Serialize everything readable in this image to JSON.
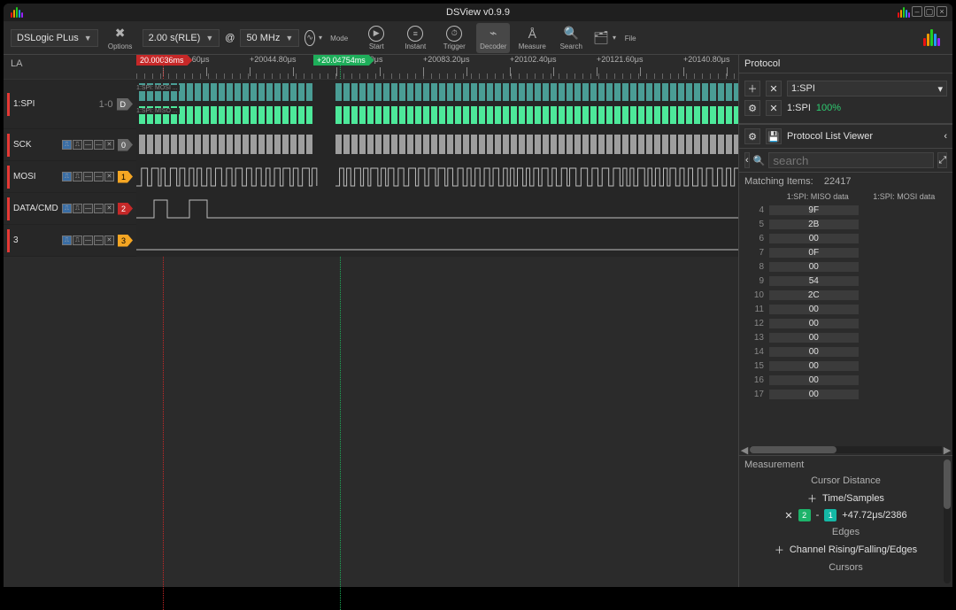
{
  "title": "DSView v0.9.9",
  "toolbar": {
    "device": "DSLogic PLus",
    "options_label": "Options",
    "duration": "2.00 s(RLE)",
    "at": "@",
    "rate": "50 MHz",
    "mode_label": "Mode",
    "start_label": "Start",
    "instant_label": "Instant",
    "trigger_label": "Trigger",
    "decoder_label": "Decoder",
    "measure_label": "Measure",
    "search_label": "Search",
    "file_label": "File"
  },
  "ruler": {
    "la": "LA",
    "cursor_red": "20.00036ms",
    "cursor_green": "+20.04754ms",
    "ticks": [
      "+20025.60μs",
      "",
      "+20044.80μs",
      "",
      "+20064.00μs",
      "",
      "+20083.20μs",
      "",
      "+20102.40μs",
      "",
      "+20121.60μs",
      "",
      "+20140.80μs",
      ""
    ]
  },
  "channels": [
    {
      "name": "1:SPI",
      "idx": "D",
      "idx_color": "grey",
      "decode": true,
      "sub": [
        "1:SPI: MOSI ...",
        "1:SPI: MISO ..."
      ]
    },
    {
      "name": "SCK",
      "idx": "0",
      "idx_color": "grey",
      "decode": false
    },
    {
      "name": "MOSI",
      "idx": "1",
      "idx_color": "orange",
      "decode": false
    },
    {
      "name": "DATA/CMD",
      "idx": "2",
      "idx_color": "red",
      "decode": false
    },
    {
      "name": "3",
      "idx": "3",
      "idx_color": "orange",
      "decode": false
    }
  ],
  "protocol": {
    "title": "Protocol",
    "selector": "1:SPI",
    "row_name": "1:SPI",
    "row_pct": "100%"
  },
  "plv": {
    "title": "Protocol List Viewer",
    "search_placeholder": "search",
    "matching_label": "Matching Items:",
    "matching_count": "22417",
    "col1": "1:SPI: MISO data",
    "col2": "1:SPI: MOSI data",
    "rows": [
      {
        "n": "4",
        "v": "9F"
      },
      {
        "n": "5",
        "v": "2B"
      },
      {
        "n": "6",
        "v": "00"
      },
      {
        "n": "7",
        "v": "0F"
      },
      {
        "n": "8",
        "v": "00"
      },
      {
        "n": "9",
        "v": "54"
      },
      {
        "n": "10",
        "v": "2C"
      },
      {
        "n": "11",
        "v": "00"
      },
      {
        "n": "12",
        "v": "00"
      },
      {
        "n": "13",
        "v": "00"
      },
      {
        "n": "14",
        "v": "00"
      },
      {
        "n": "15",
        "v": "00"
      },
      {
        "n": "16",
        "v": "00"
      },
      {
        "n": "17",
        "v": "00"
      }
    ]
  },
  "meas": {
    "title": "Measurement",
    "cursor_distance": "Cursor Distance",
    "time_samples": "Time/Samples",
    "cd_value": "+47.72μs/2386",
    "edges": "Edges",
    "edges_cols": "Channel    Rising/Falling/Edges",
    "cursors": "Cursors"
  },
  "logo_bars": [
    {
      "h": 6,
      "c": "#e11"
    },
    {
      "h": 9,
      "c": "#e90"
    },
    {
      "h": 12,
      "c": "#2c2"
    },
    {
      "h": 9,
      "c": "#29f"
    },
    {
      "h": 6,
      "c": "#92f"
    }
  ]
}
